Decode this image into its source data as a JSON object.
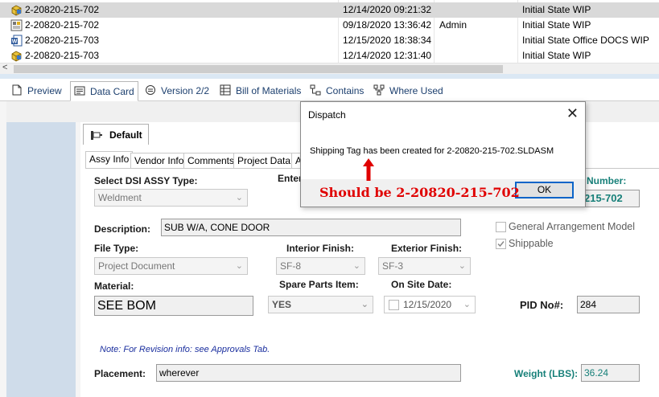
{
  "file_list": {
    "rows": [
      {
        "name": "2-20820-215-702",
        "date": "12/14/2020 09:21:32",
        "user": "",
        "state": "Initial State WIP",
        "icon": "assembly-icon",
        "selected": true
      },
      {
        "name": "2-20820-215-702",
        "date": "09/18/2020 13:36:42",
        "user": "Admin",
        "state": "Initial State WIP",
        "icon": "drawing-icon",
        "selected": false
      },
      {
        "name": "2-20820-215-703",
        "date": "12/15/2020 18:38:34",
        "user": "",
        "state": "Initial State Office DOCS WIP",
        "icon": "word-document-icon",
        "selected": false
      },
      {
        "name": "2-20820-215-703",
        "date": "12/14/2020 12:31:40",
        "user": "",
        "state": "Initial State WIP",
        "icon": "assembly-icon",
        "selected": false
      }
    ],
    "scroll_left_glyph": "<"
  },
  "tabs": [
    {
      "label": "Preview",
      "icon": "preview-icon"
    },
    {
      "label": "Data Card",
      "icon": "data-card-icon",
      "active": true
    },
    {
      "label": "Version 2/2",
      "icon": "version-icon"
    },
    {
      "label": "Bill of Materials",
      "icon": "bom-grid-icon"
    },
    {
      "label": "Contains",
      "icon": "contains-icon"
    },
    {
      "label": "Where Used",
      "icon": "where-used-icon"
    }
  ],
  "card": {
    "config_tab": "Default",
    "subtabs": [
      "Assy Info",
      "Vendor Info",
      "Comments",
      "Project Data",
      "A"
    ],
    "select_type_label": "Select DSI ASSY Type:",
    "select_type_value": "Weldment",
    "enter_label_partial": "Enter",
    "number_label_partial": "Number:",
    "number_value_partial": "215-702",
    "description_label": "Description:",
    "description_value": "SUB W/A, CONE DOOR",
    "general_arrangement_label": "General Arrangement Model",
    "shippable_label": "Shippable",
    "file_type_label": "File Type:",
    "file_type_value": "Project Document",
    "interior_finish_label": "Interior Finish:",
    "interior_finish_value": "SF-8",
    "exterior_finish_label": "Exterior Finish:",
    "exterior_finish_value": "SF-3",
    "material_label": "Material:",
    "material_value": "SEE BOM",
    "spare_parts_label": "Spare Parts Item:",
    "spare_parts_value": "YES",
    "on_site_label": "On Site Date:",
    "on_site_value": "12/15/2020",
    "pid_label": "PID No#:",
    "pid_value": "284",
    "note": "Note:   For Revision info: see Approvals Tab.",
    "placement_label": "Placement:",
    "placement_value": "wherever",
    "weight_label": "Weight (LBS):",
    "weight_value": "36.24"
  },
  "dialog": {
    "title": "Dispatch",
    "close_glyph": "✕",
    "message": "Shipping Tag  has been created for 2-20820-215-702.SLDASM",
    "ok_label": "OK"
  },
  "annotation": {
    "text": "Should be 2-20820-215-702",
    "color": "#e00000"
  }
}
